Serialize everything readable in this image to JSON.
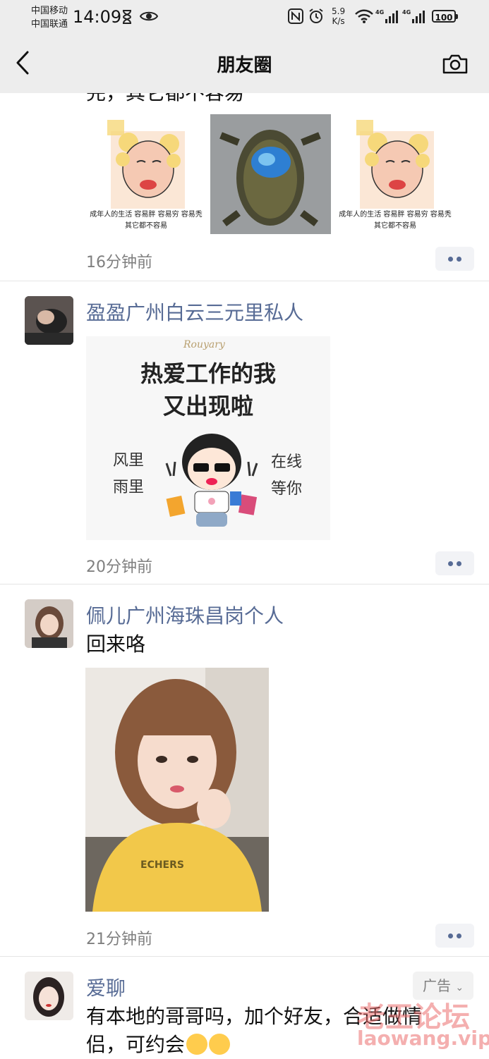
{
  "status_bar": {
    "carrier1": "中国移动",
    "carrier2": "中国联通",
    "time": "14:09",
    "net_speed": "5.9",
    "net_unit": "K/s",
    "battery": "100",
    "sig1_label": "4G",
    "sig2_label": "4G"
  },
  "nav": {
    "title": "朋友圈",
    "back_icon": "chevron-left-icon",
    "camera_icon": "camera-icon"
  },
  "feed": {
    "partial_text": "完，其它都不容易",
    "posts": [
      {
        "time": "16分钟前",
        "meme_caption_1": "成年人的生活 容易胖 容易穷 容易秃",
        "meme_caption_2": "其它都不容易"
      },
      {
        "name": "盈盈广州白云三元里私人",
        "time": "20分钟前",
        "poster": {
          "brand": "Rouyary",
          "line1": "热爱工作的我",
          "line2": "又出现啦",
          "left1": "风里",
          "left2": "雨里",
          "right1": "在线",
          "right2": "等你"
        }
      },
      {
        "name": "佩儿广州海珠昌岗个人",
        "text": "回来咯",
        "time": "21分钟前",
        "shirt_text": "ECHERS"
      },
      {
        "name": "爱聊",
        "ad_label": "广告",
        "text": "有本地的哥哥吗，加个好友，合适做情侣，可约会"
      }
    ]
  },
  "watermark": {
    "line1": "老王论坛",
    "line2": "laowang.vip"
  },
  "colors": {
    "bar_bg": "#ededed",
    "name_blue": "#576b95",
    "timestamp_gray": "#7f7f7f"
  }
}
